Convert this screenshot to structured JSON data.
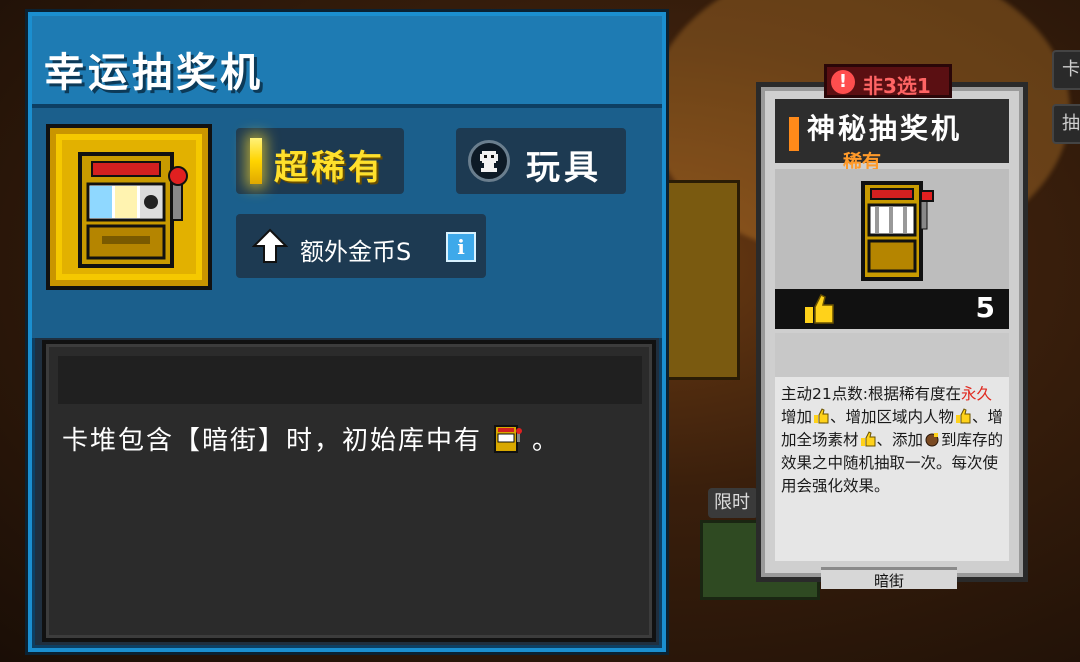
{
  "panel": {
    "title": "幸运抽奖机",
    "item_icon": "slot-machine-icon",
    "rarity_label": "超稀有",
    "rarity_color": "#ffe02c",
    "type_icon": "skull-icon",
    "type_label": "玩具",
    "bonus_icon": "arrow-up-icon",
    "bonus_label": "额外金币S",
    "info_icon_label": "i",
    "description_prefix": "卡堆包含【暗街】时，初始库中有",
    "description_suffix": "。"
  },
  "card": {
    "badge_icon_label": "!",
    "badge_label": "非3选1",
    "title": "神秘抽奖机",
    "rarity": "稀有",
    "rarity_color": "#ff9a2a",
    "cost": "5",
    "cost_icon": "thumbs-up-icon",
    "description_parts": {
      "p1": "主动21点数:根据稀有度在",
      "p1_highlight": "永久",
      "p2": "增加",
      "p3": "、增加区域内人物",
      "p4": "、增加全场素材",
      "p5": "、添加",
      "p6": "到库存的效果之中随机抽取一次。每次使用会强化效果。"
    },
    "set_name": "暗街"
  },
  "side": {
    "tag1": "卡",
    "tag2": "抽",
    "limit_label": "限时"
  }
}
